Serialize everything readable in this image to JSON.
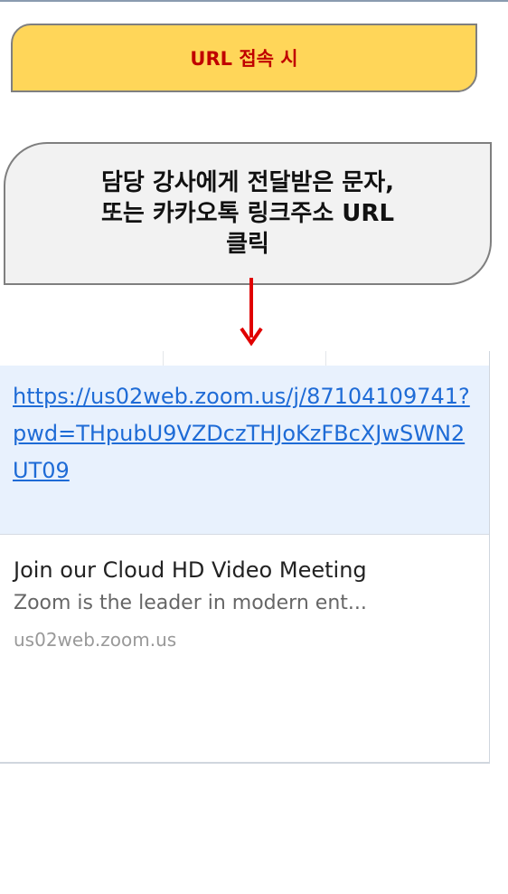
{
  "banner": {
    "text": "URL 접속 시"
  },
  "callout": {
    "text": "담당 강사에게 전달받은 문자,\n또는 카카오톡 링크주소 URL\n클릭"
  },
  "message": {
    "link_url": "https://us02web.zoom.us/j/87104109741?pwd=THpubU9VZDczTHJoKzFBcXJwSWN2UT09",
    "preview_title": "Join our Cloud HD Video Meeting",
    "preview_description": "Zoom is the leader in modern ent...",
    "preview_domain": "us02web.zoom.us"
  },
  "colors": {
    "banner_fill": "#ffd659",
    "banner_text": "#c00000",
    "arrow": "#e00000",
    "link": "#1e6bd6",
    "link_box": "#e8f1fd"
  },
  "icons": {
    "arrow": "arrow-down-icon"
  }
}
